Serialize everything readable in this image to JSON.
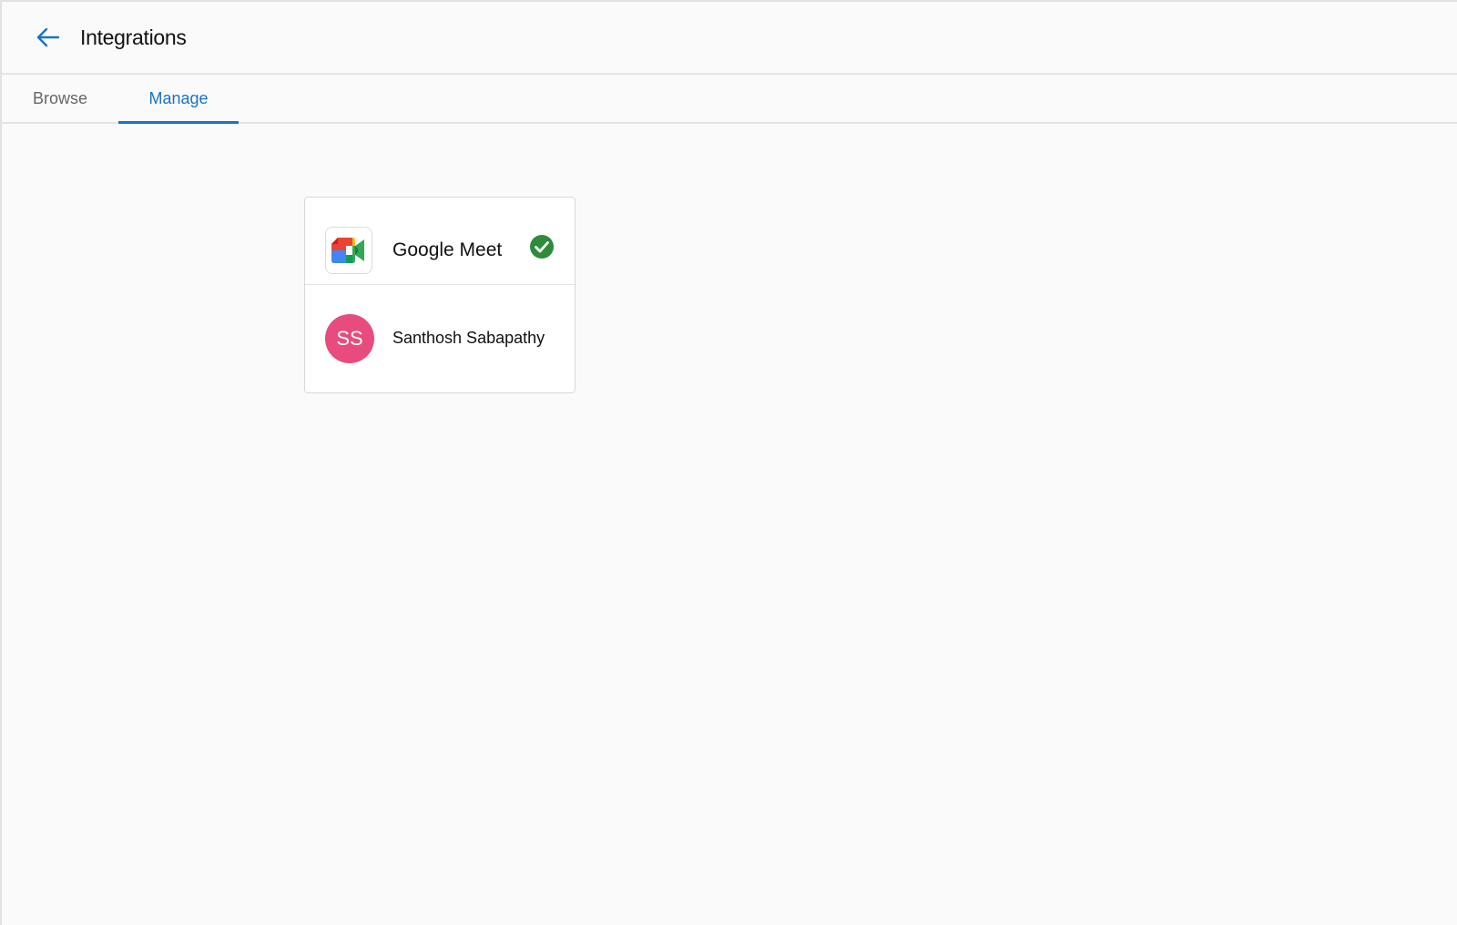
{
  "header": {
    "title": "Integrations",
    "back_icon": "arrow-left-icon"
  },
  "tabs": [
    {
      "label": "Browse",
      "active": false
    },
    {
      "label": "Manage",
      "active": true
    }
  ],
  "integration": {
    "name": "Google Meet",
    "logo_icon": "google-meet-icon",
    "status_icon": "check-circle-icon",
    "status_color": "#2e8b3a",
    "account": {
      "initials": "SS",
      "name": "Santhosh Sabapathy",
      "avatar_color": "#e84b7e"
    }
  },
  "colors": {
    "accent": "#1a73c8",
    "background": "#fafafa"
  }
}
